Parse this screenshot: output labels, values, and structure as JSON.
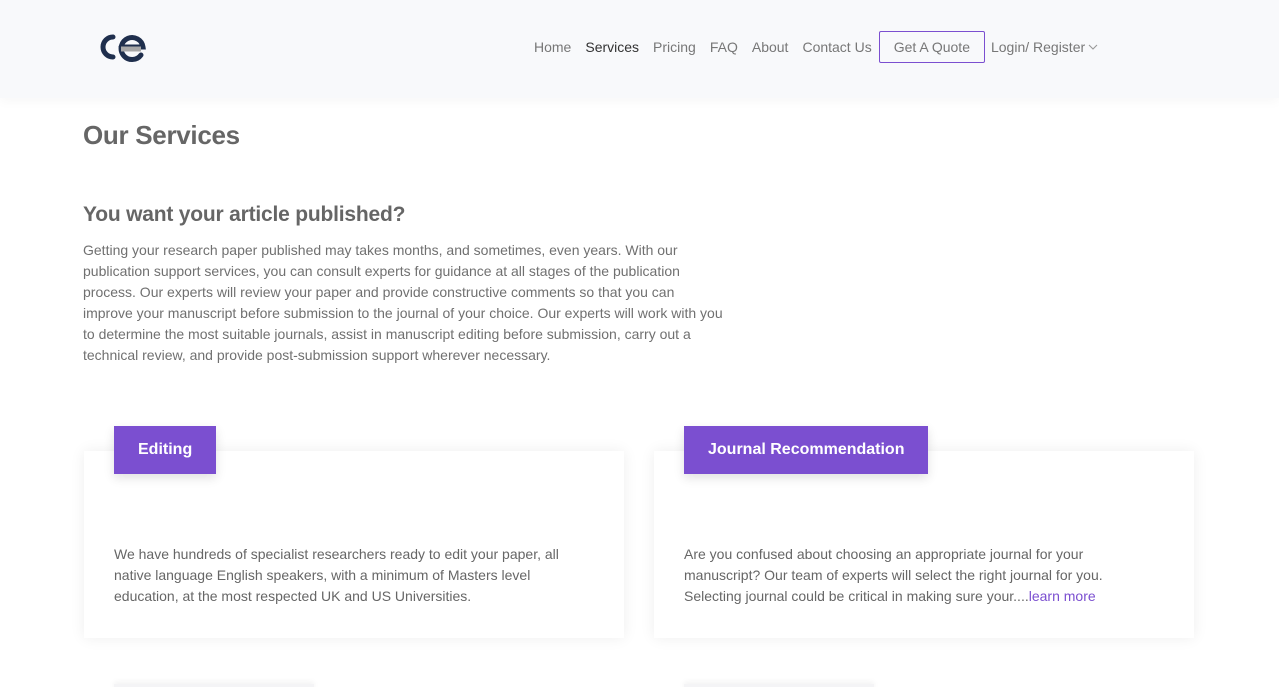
{
  "header": {
    "logo_text": "ce",
    "nav": [
      "Home",
      "Services",
      "Pricing",
      "FAQ",
      "About",
      "Contact Us"
    ],
    "active_nav": "Services",
    "quote_button": "Get A Quote",
    "login_label": "Login/ Register",
    "login_icon": "chevron-down-icon"
  },
  "page": {
    "title": "Our Services",
    "subtitle": "You want your article published?",
    "intro": "Getting your research paper published may takes months, and sometimes, even years. With our publication support services, you can consult experts for guidance at all stages of the publication process. Our experts will review your paper and provide constructive comments so that you can improve your manuscript before submission to the journal of your choice. Our experts will work with you to determine the most suitable journals, assist in manuscript editing before submission, carry out a technical review, and provide post-submission support wherever necessary."
  },
  "cards": [
    {
      "title": "Editing",
      "text": "We have hundreds of specialist researchers ready to edit your paper, all native language English speakers, with a minimum of Masters level education, at the most respected UK and US Universities."
    },
    {
      "title": "Journal Recommendation",
      "text": "Are you confused about choosing an appropriate journal for your manuscript? Our team of experts will select the right journal for you. Selecting journal could be critical in making sure your....",
      "link": "learn more"
    }
  ],
  "colors": {
    "accent": "#7b4fd0",
    "logo_dark": "#1f2f4d",
    "logo_grey": "#a7a7a7"
  }
}
